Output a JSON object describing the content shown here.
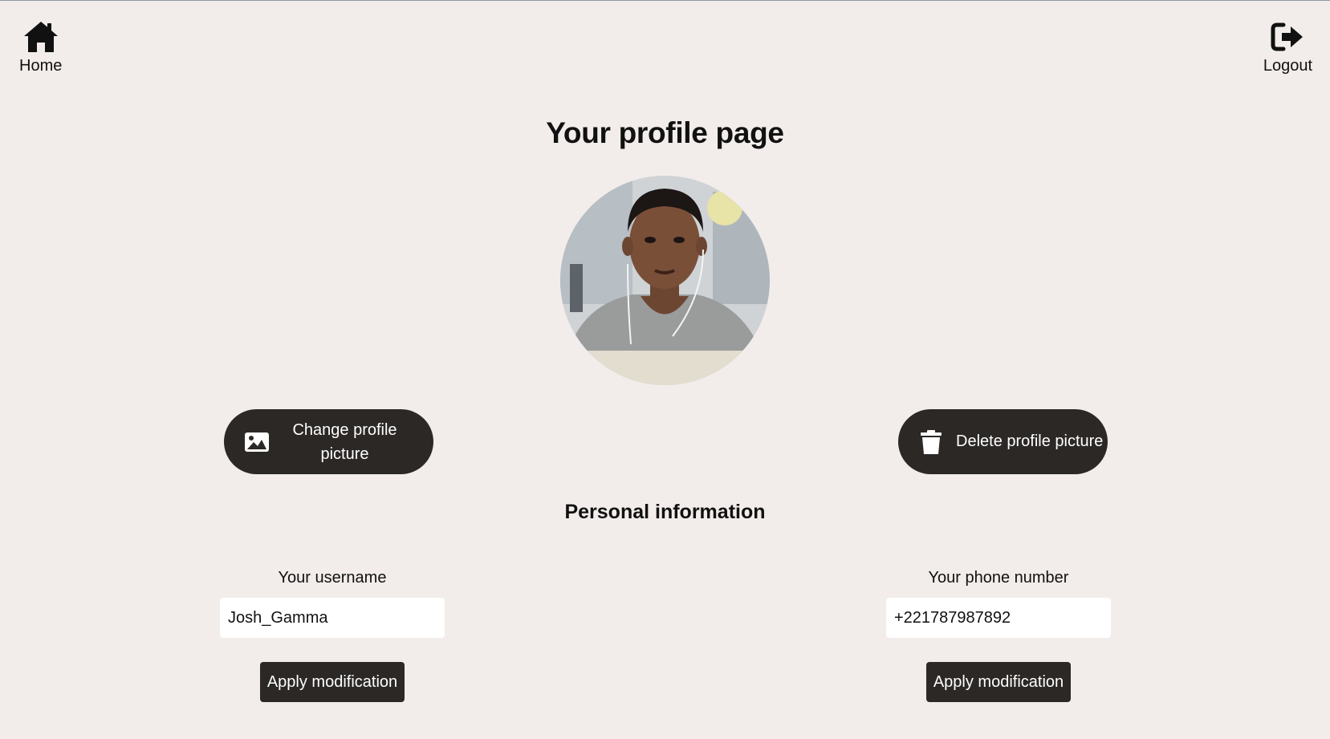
{
  "nav": {
    "home": {
      "label": "Home",
      "icon": "home-icon"
    },
    "logout": {
      "label": "Logout",
      "icon": "logout-icon"
    }
  },
  "page": {
    "title": "Your profile page"
  },
  "profile_picture": {
    "buttons": {
      "change": {
        "label_line1": "Change profile",
        "label_line2": "picture",
        "icon": "image-icon"
      },
      "delete": {
        "label": "Delete profile picture",
        "icon": "trash-icon"
      }
    }
  },
  "personal_info": {
    "title": "Personal information",
    "username": {
      "label": "Your username",
      "value": "Josh_Gamma",
      "apply_label": "Apply modification"
    },
    "phone": {
      "label": "Your phone number",
      "value": "+221787987892",
      "apply_label": "Apply modification"
    }
  },
  "colors": {
    "background": "#f2edea",
    "button": "#2b2826",
    "button_text": "#ffffff",
    "input_bg": "#ffffff"
  }
}
